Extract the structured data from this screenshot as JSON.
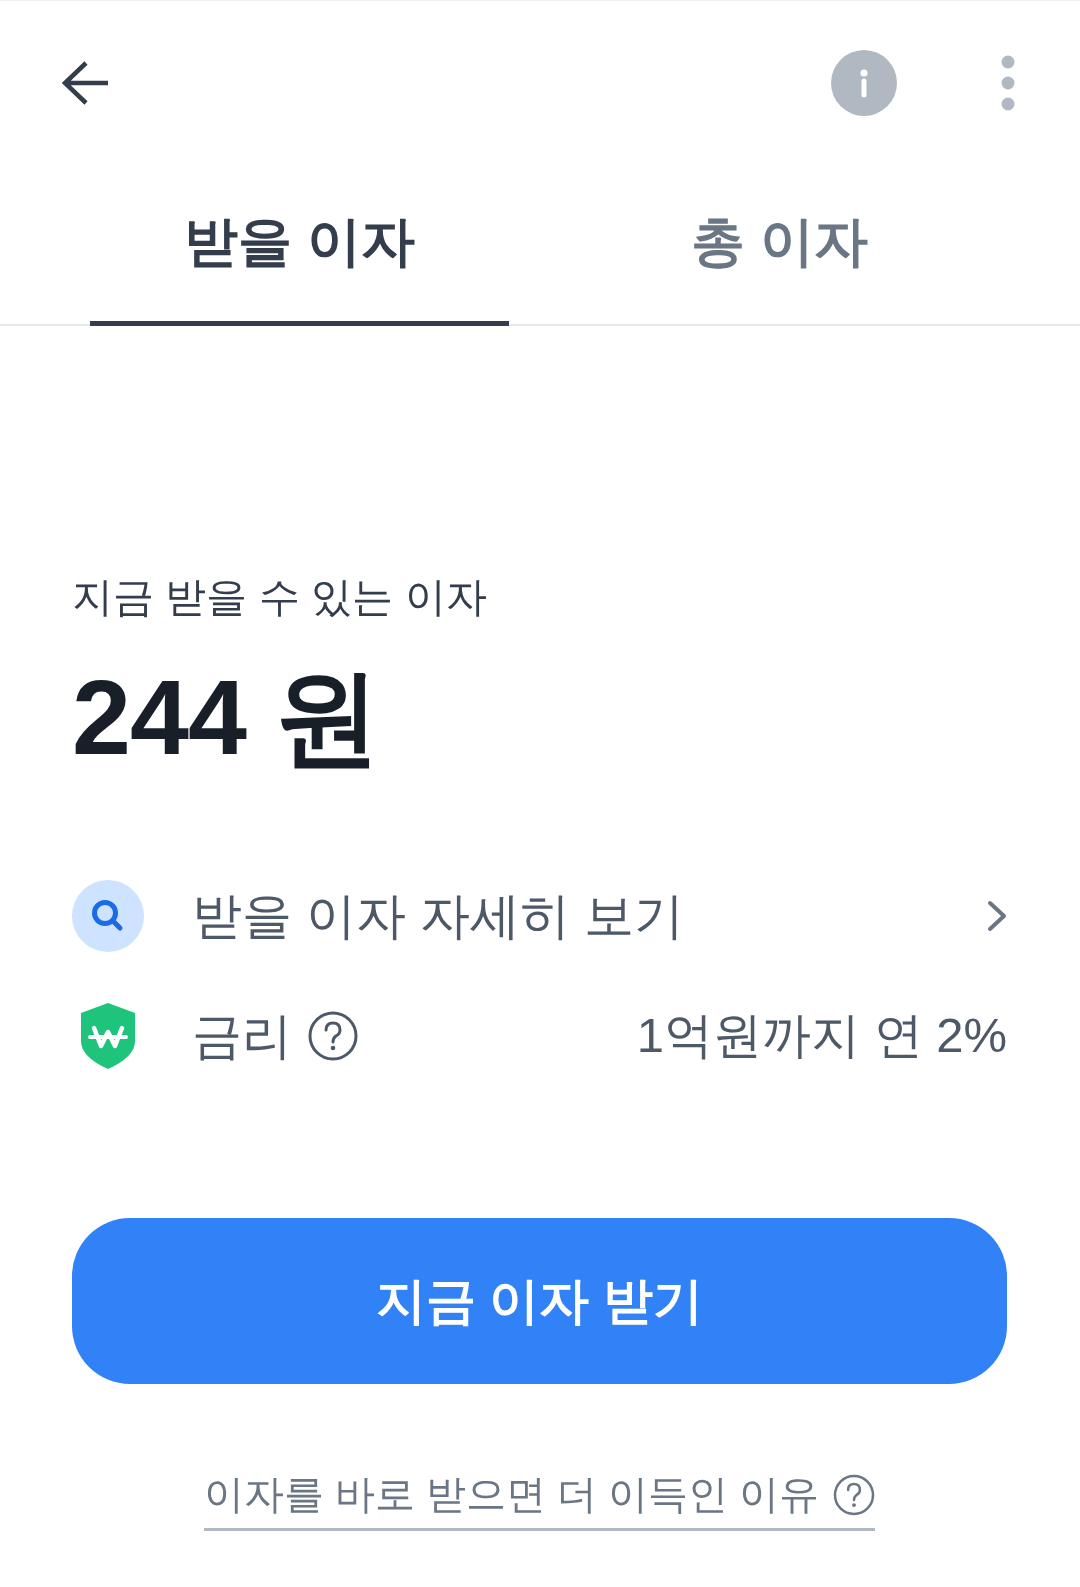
{
  "tabs": [
    {
      "label": "받을 이자",
      "selected": true
    },
    {
      "label": "총 이자",
      "selected": false
    }
  ],
  "summary": {
    "label": "지금 받을 수 있는 이자",
    "amount": "244 원"
  },
  "rows": [
    {
      "kind": "link",
      "label": "받을 이자 자세히 보기"
    },
    {
      "kind": "info",
      "label": "금리",
      "value": "1억원까지 연 2%"
    }
  ],
  "primary_button": {
    "label": "지금 이자 받기"
  },
  "help_link": {
    "label": "이자를 바로 받으면 더 이득인 이유"
  }
}
